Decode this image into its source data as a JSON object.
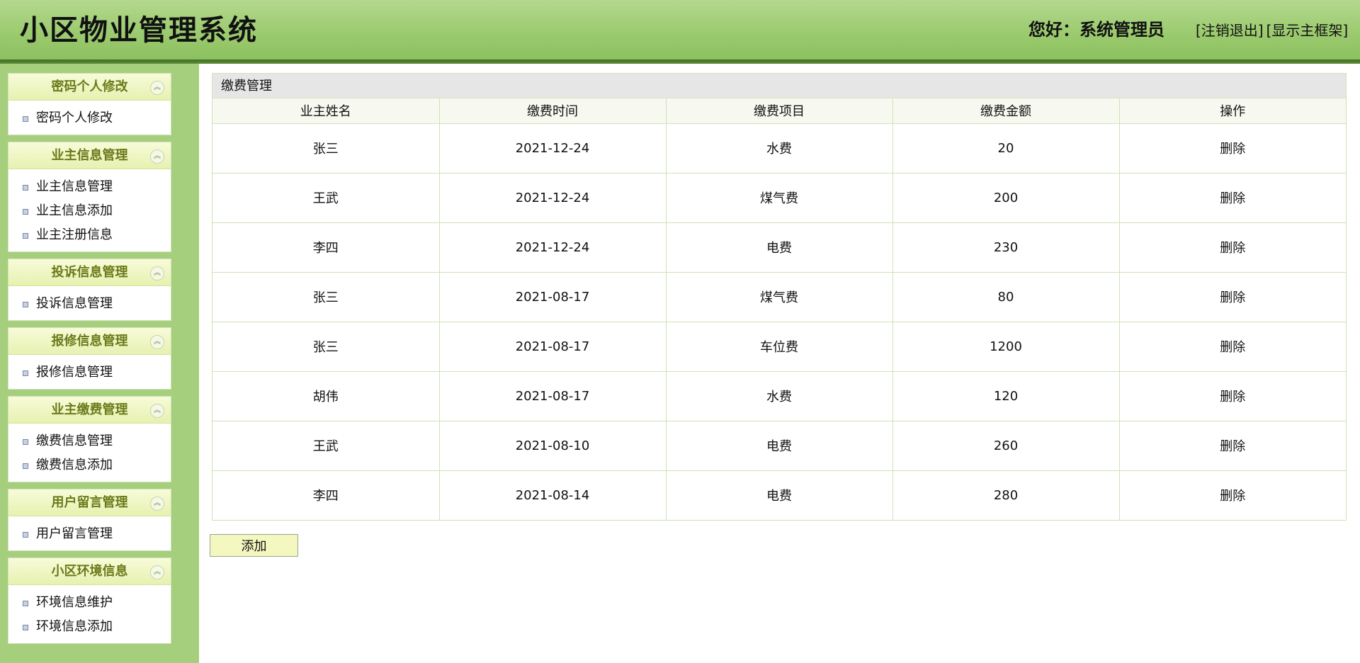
{
  "header": {
    "site_title": "小区物业管理系统",
    "greeting_label": "您好：",
    "user_name": "系统管理员",
    "logout_label": "[注销退出]",
    "show_frame_label": "[显示主框架]"
  },
  "sidebar": {
    "groups": [
      {
        "title": "密码个人修改",
        "items": [
          "密码个人修改"
        ]
      },
      {
        "title": "业主信息管理",
        "items": [
          "业主信息管理",
          "业主信息添加",
          "业主注册信息"
        ]
      },
      {
        "title": "投诉信息管理",
        "items": [
          "投诉信息管理"
        ]
      },
      {
        "title": "报修信息管理",
        "items": [
          "报修信息管理"
        ]
      },
      {
        "title": "业主缴费管理",
        "items": [
          "缴费信息管理",
          "缴费信息添加"
        ]
      },
      {
        "title": "用户留言管理",
        "items": [
          "用户留言管理"
        ]
      },
      {
        "title": "小区环境信息",
        "items": [
          "环境信息维护",
          "环境信息添加"
        ]
      }
    ]
  },
  "main": {
    "panel_title": "缴费管理",
    "columns": [
      "业主姓名",
      "缴费时间",
      "缴费项目",
      "缴费金额",
      "操作"
    ],
    "rows": [
      [
        "张三",
        "2021-12-24",
        "水费",
        "20",
        "删除"
      ],
      [
        "王武",
        "2021-12-24",
        "煤气费",
        "200",
        "删除"
      ],
      [
        "李四",
        "2021-12-24",
        "电费",
        "230",
        "删除"
      ],
      [
        "张三",
        "2021-08-17",
        "煤气费",
        "80",
        "删除"
      ],
      [
        "张三",
        "2021-08-17",
        "车位费",
        "1200",
        "删除"
      ],
      [
        "胡伟",
        "2021-08-17",
        "水费",
        "120",
        "删除"
      ],
      [
        "王武",
        "2021-08-10",
        "电费",
        "260",
        "删除"
      ],
      [
        "李四",
        "2021-08-14",
        "电费",
        "280",
        "删除"
      ]
    ],
    "add_button_label": "添加"
  }
}
